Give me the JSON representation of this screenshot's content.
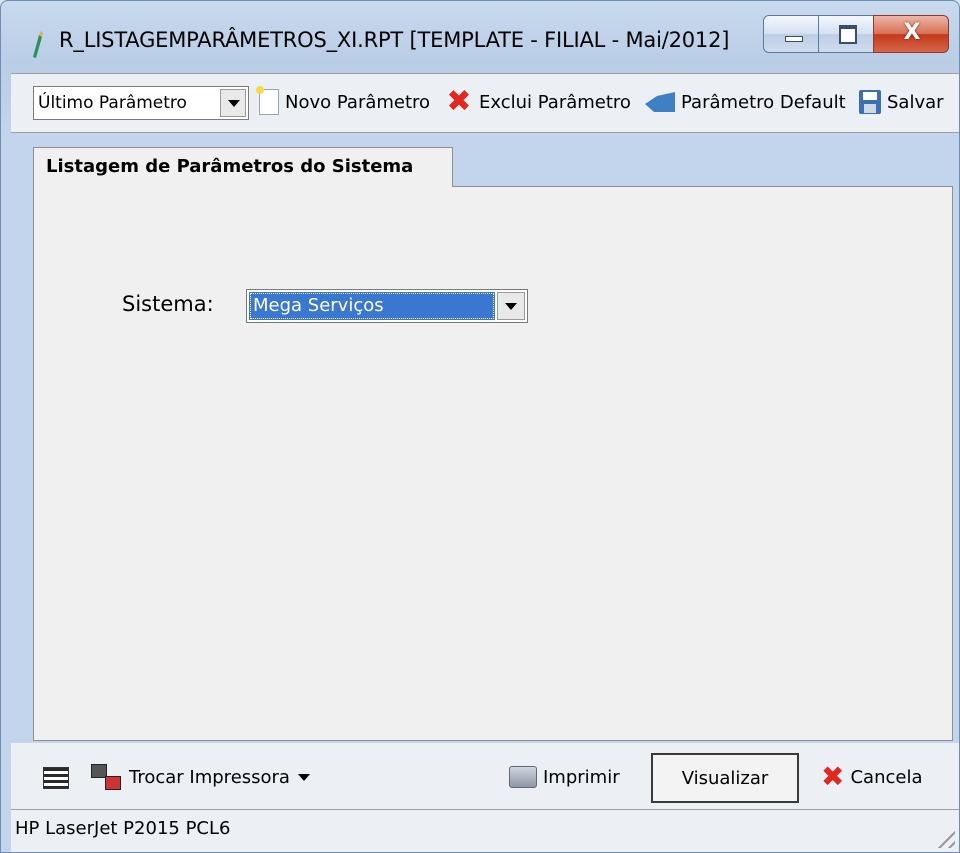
{
  "window": {
    "title": "R_LISTAGEMPARÂMETROS_XI.RPT [TEMPLATE - FILIAL - Mai/2012]",
    "controls": {
      "minimize": "",
      "maximize": "",
      "close": "X"
    }
  },
  "toolbar": {
    "param_combo_value": "Último Parâmetro",
    "new_label": "Novo Parâmetro",
    "delete_label": "Exclui Parâmetro",
    "default_label": "Parâmetro Default",
    "save_label": "Salvar"
  },
  "tab": {
    "label": "Listagem de Parâmetros do Sistema"
  },
  "form": {
    "sistema_label": "Sistema:",
    "sistema_value": "Mega Serviços"
  },
  "bottombar": {
    "switch_printer_label": "Trocar Impressora",
    "print_label": "Imprimir",
    "preview_label": "Visualizar",
    "cancel_label": "Cancela"
  },
  "status": {
    "printer": "HP LaserJet P2015 PCL6"
  },
  "colors": {
    "accent": "#3a77d0",
    "close_button": "#c2391a",
    "delete_icon": "#e0281f"
  }
}
